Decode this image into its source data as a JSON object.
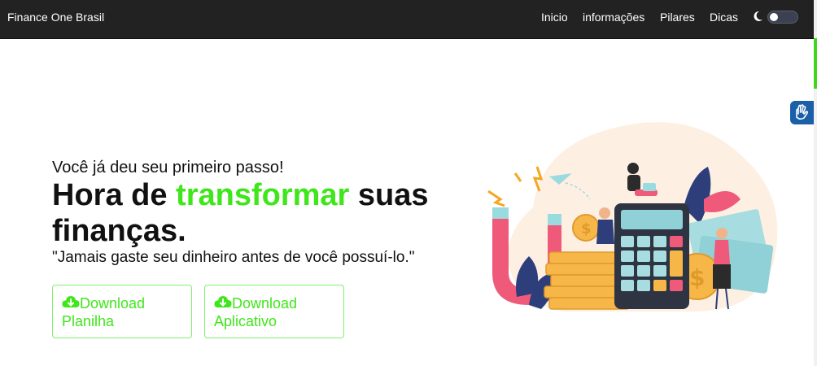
{
  "nav": {
    "brand": "Finance One Brasil",
    "items": [
      "Inicio",
      "informações",
      "Pilares",
      "Dicas"
    ],
    "theme_icon": "moon-icon",
    "theme_toggle_on": false
  },
  "hero": {
    "subtitle": "Você já deu seu primeiro passo!",
    "headline_before": "Hora de ",
    "headline_accent": "transformar",
    "headline_after": " suas finanças.",
    "quote": "\"Jamais gaste seu dinheiro antes de você possuí-lo.\"",
    "buttons": [
      {
        "line1": "Download",
        "line2": "Planilha",
        "icon": "cloud-download-icon"
      },
      {
        "line1": "Download",
        "line2": "Aplicativo",
        "icon": "cloud-download-icon"
      }
    ]
  },
  "widgets": {
    "accessibility_icon": "sign-language-icon"
  },
  "colors": {
    "navbar_bg": "#222222",
    "accent_green": "#3fe61a",
    "button_border": "#7ff06a",
    "scroll_thumb": "#3fd61b",
    "a11y_bg": "#1a5fa8"
  }
}
